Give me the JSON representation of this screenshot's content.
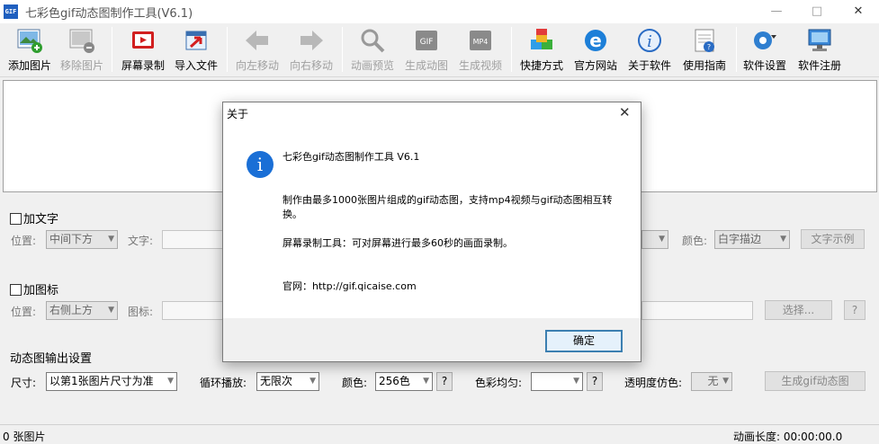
{
  "window": {
    "title": "七彩色gif动态图制作工具(V6.1)",
    "app_icon_text": "GIF"
  },
  "toolbar": {
    "items": [
      {
        "label": "添加图片",
        "icon": "add-image-icon",
        "enabled": true
      },
      {
        "label": "移除图片",
        "icon": "remove-image-icon",
        "enabled": false
      },
      {
        "label": "屏幕录制",
        "icon": "screen-record-icon",
        "enabled": true
      },
      {
        "label": "导入文件",
        "icon": "import-file-icon",
        "enabled": true
      },
      {
        "label": "向左移动",
        "icon": "arrow-left-icon",
        "enabled": false
      },
      {
        "label": "向右移动",
        "icon": "arrow-right-icon",
        "enabled": false
      },
      {
        "label": "动画预览",
        "icon": "magnifier-icon",
        "enabled": false
      },
      {
        "label": "生成动图",
        "icon": "gif-icon",
        "enabled": false
      },
      {
        "label": "生成视频",
        "icon": "mp4-icon",
        "enabled": false
      },
      {
        "label": "快捷方式",
        "icon": "cubes-icon",
        "enabled": true
      },
      {
        "label": "官方网站",
        "icon": "ie-icon",
        "enabled": true
      },
      {
        "label": "关于软件",
        "icon": "info-icon",
        "enabled": true
      },
      {
        "label": "使用指南",
        "icon": "help-doc-icon",
        "enabled": true
      },
      {
        "label": "软件设置",
        "icon": "gear-icon",
        "enabled": true
      },
      {
        "label": "软件注册",
        "icon": "monitor-icon",
        "enabled": true
      }
    ],
    "gif_badge": "GIF",
    "mp4_badge": "MP4"
  },
  "text_section": {
    "title": "加文字",
    "position_label": "位置:",
    "position_value": "中间下方",
    "text_label": "文字:",
    "color_label": "颜色:",
    "color_value": "白字描边",
    "sample_button": "文字示例"
  },
  "icon_section": {
    "title": "加图标",
    "position_label": "位置:",
    "position_value": "右侧上方",
    "icon_label": "图标:",
    "select_button": "选择...",
    "help_button": "?"
  },
  "output_section": {
    "title": "动态图输出设置",
    "size_label": "尺寸:",
    "size_value": "以第1张图片尺寸为准",
    "loop_label": "循环播放:",
    "loop_value": "无限次",
    "colors_label": "颜色:",
    "colors_value": "256色",
    "balance_label": "色彩均匀:",
    "balance_value": "",
    "dither_label": "透明度仿色:",
    "dither_value": "无",
    "generate_button": "生成gif动态图",
    "help_button": "?"
  },
  "status": {
    "count": "0 张图片",
    "duration": "动画长度: 00:00:00.0"
  },
  "dialog": {
    "title": "关于",
    "app_name": "七彩色gif动态图制作工具 V6.1",
    "desc_line1": "制作由最多1000张图片组成的gif动态图，支持mp4视频与gif动态图相互转",
    "desc_line2": "换。",
    "record_info": "屏幕录制工具：可对屏幕进行最多60秒的画面录制。",
    "website": "官网：http://gif.qicaise.com",
    "ok_button": "确定"
  }
}
